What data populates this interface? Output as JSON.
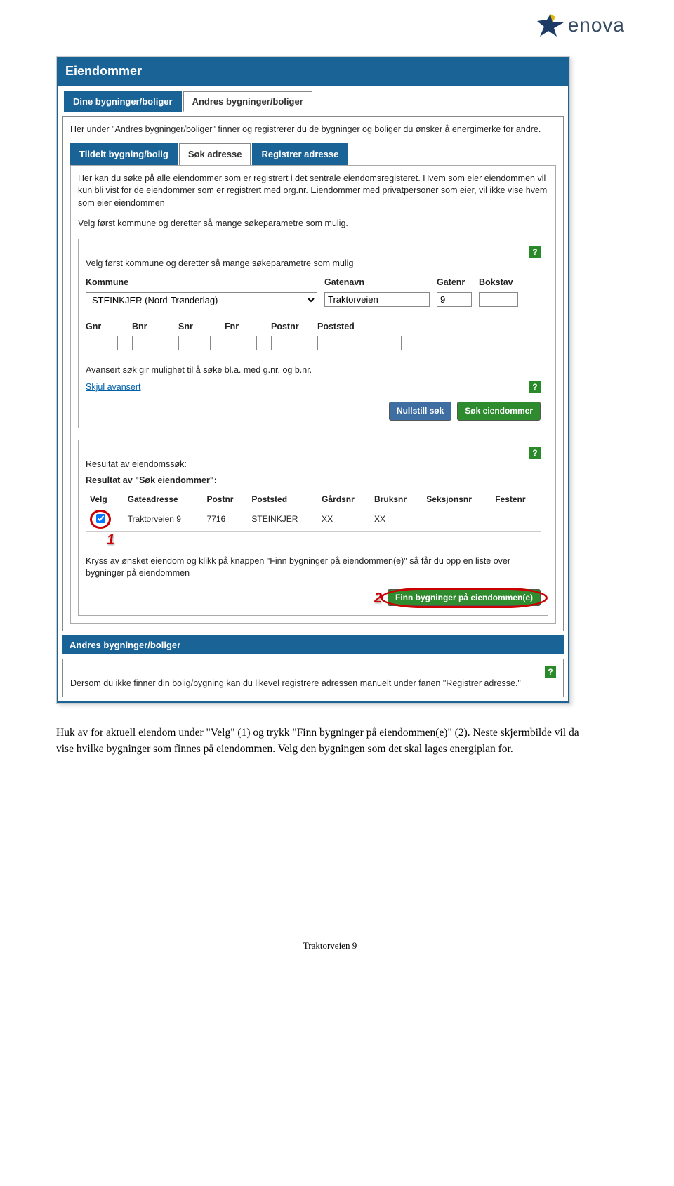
{
  "logo": {
    "text": "enova"
  },
  "panel": {
    "title": "Eiendommer"
  },
  "tabs": {
    "mine": "Dine bygninger/boliger",
    "andre": "Andres bygninger/boliger"
  },
  "andre_intro": "Her under \"Andres bygninger/boliger\" finner og registrerer du de bygninger og boliger du ønsker å energimerke for andre.",
  "subtabs": {
    "tildelt": "Tildelt bygning/bolig",
    "sok": "Søk adresse",
    "registrer": "Registrer adresse"
  },
  "sok_intro": "Her kan du søke på alle eiendommer som er registrert i det sentrale eiendomsregisteret. Hvem som eier eiendommen vil kun bli vist for de eiendommer som er registrert med org.nr. Eiendommer med privatpersoner som eier, vil ikke vise hvem som eier eiendommen",
  "velg_hint1": "Velg først kommune og deretter så mange søkeparametre som mulig.",
  "velg_hint2": "Velg først kommune og deretter så mange søkeparametre som mulig",
  "labels": {
    "kommune": "Kommune",
    "gatenavn": "Gatenavn",
    "gatenr": "Gatenr",
    "bokstav": "Bokstav",
    "gnr": "Gnr",
    "bnr": "Bnr",
    "snr": "Snr",
    "fnr": "Fnr",
    "postnr": "Postnr",
    "poststed": "Poststed"
  },
  "values": {
    "kommune": "STEINKJER (Nord-Trønderlag)",
    "gatenavn": "Traktorveien",
    "gatenr": "9"
  },
  "adv_text": "Avansert søk gir mulighet til å søke bl.a. med g.nr. og b.nr.",
  "skjul": "Skjul avansert",
  "buttons": {
    "nullstill": "Nullstill søk",
    "sok": "Søk eiendommer",
    "finn": "Finn bygninger på eiendommen(e)"
  },
  "result": {
    "heading1": "Resultat av eiendomssøk:",
    "heading2": "Resultat av \"Søk eiendommer\":",
    "cols": {
      "velg": "Velg",
      "gate": "Gateadresse",
      "postnr": "Postnr",
      "poststed": "Poststed",
      "gardsnr": "Gårdsnr",
      "bruksnr": "Bruksnr",
      "seksjonsnr": "Seksjonsnr",
      "festenr": "Festenr"
    },
    "row": {
      "gate": "Traktorveien 9",
      "postnr": "7716",
      "poststed": "STEINKJER",
      "gardsnr": "XX",
      "bruksnr": "XX"
    },
    "hint": "Kryss av ønsket eiendom og klikk på knappen \"Finn bygninger på eiendommen(e)\" så får du opp en liste over bygninger på eiendommen"
  },
  "markers": {
    "one": "1",
    "two": "2"
  },
  "subheader": "Andres bygninger/boliger",
  "manual_hint": "Dersom du ikke finner din bolig/bygning kan du likevel registrere adressen manuelt under fanen \"Registrer adresse.\"",
  "document_text": "Huk av for aktuell eiendom under \"Velg\" (1) og trykk \"Finn bygninger på eiendommen(e)\" (2). Neste skjermbilde vil da vise hvilke bygninger som finnes på eiendommen. Velg den bygningen som det skal lages energiplan for.",
  "footer": "Traktorveien 9"
}
